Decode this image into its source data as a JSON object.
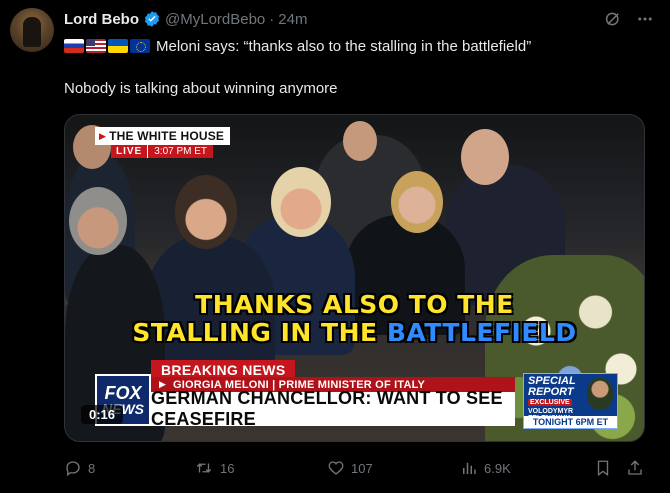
{
  "tweet": {
    "author_name": "Lord Bebo",
    "handle": "@MyLordBebo",
    "separator": "·",
    "time": "24m",
    "text_line1": "Meloni says: “thanks also to the stalling in the battlefield”",
    "text_line2": "Nobody is talking about winning anymore",
    "flags": [
      "russia-flag",
      "usa-flag",
      "ukraine-flag",
      "eu-flag"
    ]
  },
  "video": {
    "channel_logo": "THE WHITE HOUSE",
    "live_label": "LIVE",
    "live_time": "3:07 PM ET",
    "caption_line1": "THANKS ALSO TO THE",
    "caption_line2_prefix": "STALLING IN THE ",
    "caption_line2_highlight": "BATTLEFIELD",
    "breaking_label": "BREAKING NEWS",
    "subline": "GIORGIA MELONI | PRIME MINISTER OF ITALY",
    "headline": "GERMAN CHANCELLOR: WANT TO SEE CEASEFIRE",
    "network_logo_line1": "FOX",
    "network_logo_line2": "NEWS",
    "special_title": "SPECIAL REPORT",
    "special_exclusive": "EXCLUSIVE",
    "special_name": "VOLODYMYR ZELENSKYY",
    "special_tonight": "TONIGHT 6PM ET",
    "duration": "0:16"
  },
  "actions": {
    "replies": "8",
    "reposts": "16",
    "likes": "107",
    "views": "6.9K"
  },
  "colors": {
    "background": "#000000",
    "text_primary": "#e7e9ea",
    "text_secondary": "#71767b",
    "verified_blue": "#1d9bf0",
    "caption_yellow": "#ffe42b",
    "caption_blue": "#2f8bff",
    "fox_red": "#c4161c"
  }
}
